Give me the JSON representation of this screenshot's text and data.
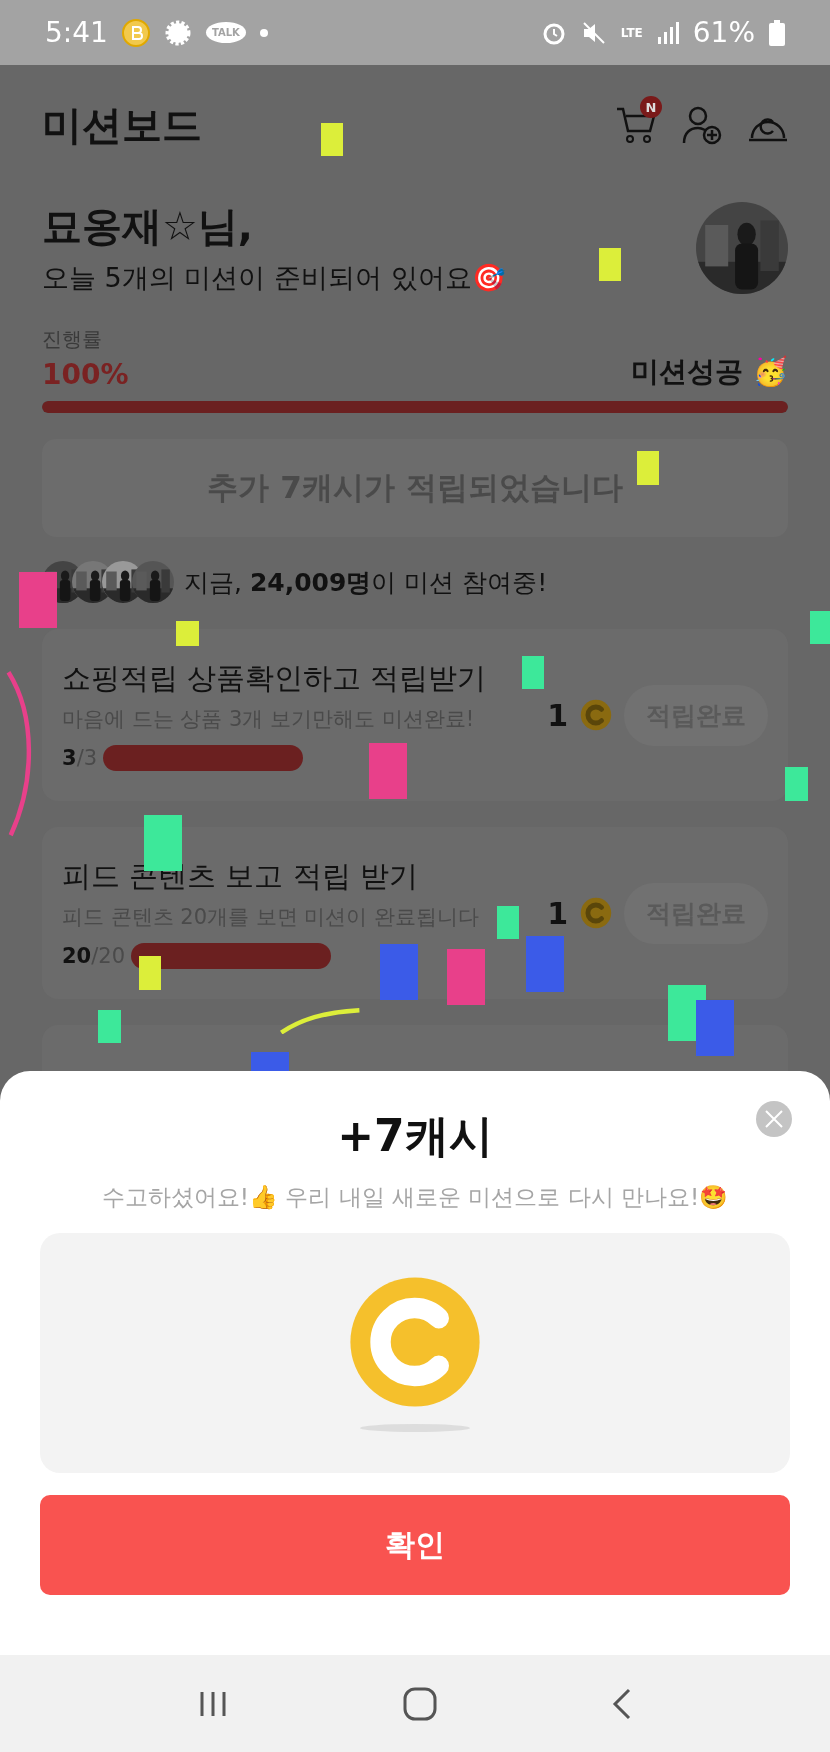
{
  "status_bar": {
    "time": "5:41",
    "chat_label": "TALK",
    "network": "LTE",
    "battery": "61%"
  },
  "header": {
    "title": "미션보드",
    "cart_badge": "N"
  },
  "greeting": {
    "name": "묘옹재☆님,",
    "message": "오늘 5개의 미션이 준비되어 있어요🎯"
  },
  "progress": {
    "label": "진행률",
    "percent": "100%",
    "level": 1,
    "status": "미션성공 🥳"
  },
  "banner": "추가 7캐시가 적립되었습니다",
  "participants": "지금, **24,009명**이 미션 참여중!",
  "missions": [
    {
      "title": "쇼핑적립 상품확인하고 적립받기",
      "description": "마음에 드는 상품 3개 보기만해도 미션완료!",
      "done": "3",
      "total": "/3",
      "level": 1,
      "reward": "1",
      "button": "적립완료",
      "completed": true
    },
    {
      "title": "피드 콘텐츠 보고 적립 받기",
      "description": "피드 콘텐츠 20개를 보면 미션이 완료됩니다",
      "done": "20",
      "total": "/20",
      "level": 1,
      "reward": "1",
      "button": "적립완료",
      "completed": true
    }
  ],
  "sheet": {
    "title": "+7캐시",
    "message": "수고하셨어요!👍 우리 내일 새로운 미션으로 다시 만나요!🤩",
    "confirm": "확인"
  }
}
